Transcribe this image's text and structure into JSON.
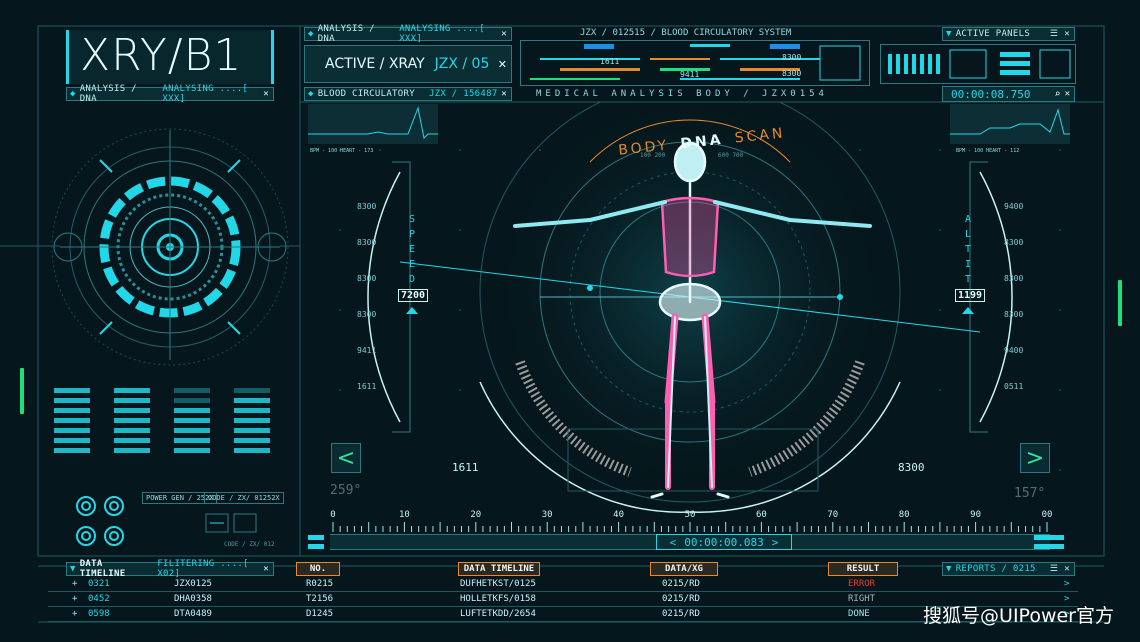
{
  "title": "XRY/B1",
  "top_tabs": {
    "analysis_label": "ANALYSIS / DNA",
    "analysis_status": "ANALYSING ....[ XXX]",
    "active_label": "ACTIVE / XRAY",
    "active_code": "JZX / 05",
    "system_title": "JZX / 012515 / BLOOD CIRCULATORY SYSTEM",
    "active_panels": "ACTIVE PANELS"
  },
  "left_panel": {
    "header_label": "ANALYSIS / DNA",
    "header_status": "ANALYSING ....[ XXX]",
    "power_label": "POWER GEN / 252X",
    "code_label": "CODE / ZX/ 01252X",
    "code_small": "CODE / ZX/ 012"
  },
  "blood_panel": {
    "label": "BLOOD CIRCULATORY",
    "code": "JZX / 156487",
    "bpm_left": "BPM - 100 HEART - 173",
    "bpm_right": "BPM - 100 HEART - 112"
  },
  "medical_banner": "MEDICAL ANALYSIS BODY / JZX0154",
  "timer_top": "00:00:08.750",
  "scan": {
    "arc_text_1": "BODY",
    "arc_text_2": "DNA",
    "arc_text_3": "SCAN",
    "arc_small_left": "100 200",
    "arc_small_right": "600 700"
  },
  "speed": {
    "label": "SPEED",
    "value": "7200"
  },
  "altit": {
    "label": "ALTIT",
    "value": "1199"
  },
  "left_ticks": [
    "8300",
    "8300",
    "8300",
    "8300",
    "9411",
    "1611"
  ],
  "right_ticks": [
    "9400",
    "8300",
    "8300",
    "8300",
    "9400",
    "0511"
  ],
  "mini_left": [
    "1611",
    "9411"
  ],
  "mini_right": [
    "8300",
    "8300"
  ],
  "lower_left_value": "1611",
  "lower_right_value": "8300",
  "angle_left": "259°",
  "angle_right": "157°",
  "scale": [
    "0",
    "10",
    "20",
    "30",
    "40",
    "50",
    "60",
    "70",
    "80",
    "90",
    "00"
  ],
  "timer_bottom": "00:00:00.083",
  "table": {
    "header_left": "DATA TIMELINE",
    "header_filter": "FILITERING ....[ X02]",
    "header_reports": "REPORTS / 0215",
    "columns": [
      "NO.",
      "DATA TIMELINE",
      "DATA/XG",
      "RESULT"
    ],
    "rows": [
      {
        "id": "0321",
        "code": "JZX0125",
        "no": "R0215",
        "timeline": "DUFHETKST/0125",
        "xg": "0215/RD",
        "result": "ERROR"
      },
      {
        "id": "0452",
        "code": "DHA0358",
        "no": "T2156",
        "timeline": "HOLLETKFS/0158",
        "xg": "0215/RD",
        "result": "RIGHT"
      },
      {
        "id": "0598",
        "code": "DTA0489",
        "no": "D1245",
        "timeline": "LUFTETKDD/2654",
        "xg": "0215/RD",
        "result": "DONE"
      }
    ]
  },
  "watermark": "搜狐号@UIPower官方",
  "colors": {
    "accent": "#22d8e8",
    "orange": "#e8892a",
    "error": "#e83a2a",
    "green": "#1de07a"
  }
}
